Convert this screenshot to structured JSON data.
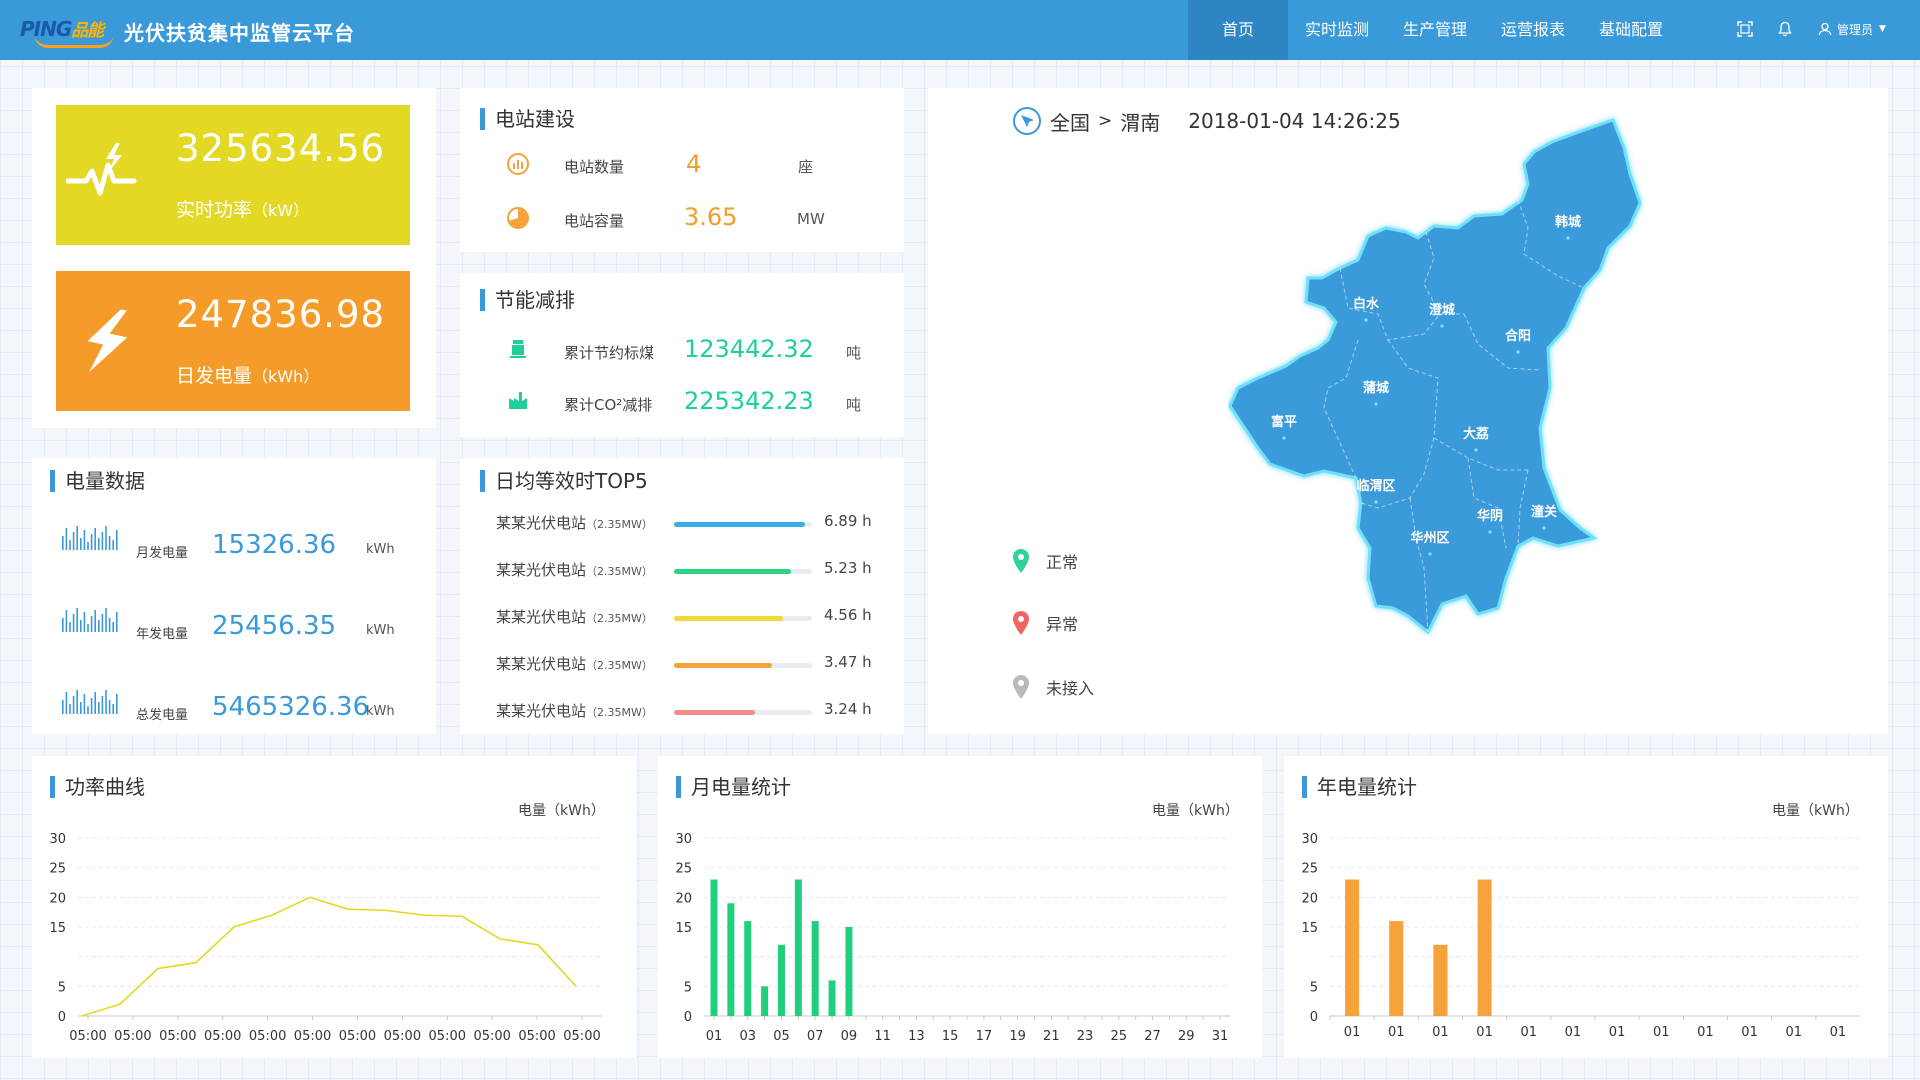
{
  "header": {
    "logo_latin": "PING",
    "logo_cn": "品能",
    "title": "光伏扶贫集中监管云平台",
    "nav": [
      {
        "label": "首页",
        "active": true
      },
      {
        "label": "实时监测",
        "active": false
      },
      {
        "label": "生产管理",
        "active": false
      },
      {
        "label": "运营报表",
        "active": false
      },
      {
        "label": "基础配置",
        "active": false
      }
    ],
    "user": "管理员"
  },
  "stats": {
    "realtime_power": {
      "value": "325634.56",
      "label": "实时功率",
      "unit": "（kW）",
      "color": "#e3d924"
    },
    "daily_energy": {
      "value": "247836.98",
      "label": "日发电量",
      "unit": "（kWh）",
      "color": "#f59b29"
    }
  },
  "station": {
    "title": "电站建设",
    "count": {
      "label": "电站数量",
      "value": "4",
      "unit": "座"
    },
    "capacity": {
      "label": "电站容量",
      "value": "3.65",
      "unit": "MW"
    }
  },
  "saving": {
    "title": "节能减排",
    "coal": {
      "label": "累计节约标煤",
      "value": "123442.32",
      "unit": "吨"
    },
    "co2": {
      "label": "累计CO²减排",
      "value": "225342.23",
      "unit": "吨"
    }
  },
  "energy": {
    "title": "电量数据",
    "monthly": {
      "label": "月发电量",
      "value": "15326.36",
      "unit": "kWh"
    },
    "yearly": {
      "label": "年发电量",
      "value": "25456.35",
      "unit": "kWh"
    },
    "total": {
      "label": "总发电量",
      "value": "5465326.36",
      "unit": "kWh"
    }
  },
  "top5": {
    "title": "日均等效时TOP5",
    "items": [
      {
        "name": "某某光伏电站",
        "cap": "（2.35MW）",
        "value": "6.89 h",
        "ratio": 0.95,
        "color": "#3aade6"
      },
      {
        "name": "某某光伏电站",
        "cap": "（2.35MW）",
        "value": "5.23 h",
        "ratio": 0.85,
        "color": "#2fd27e"
      },
      {
        "name": "某某光伏电站",
        "cap": "（2.35MW）",
        "value": "4.56 h",
        "ratio": 0.79,
        "color": "#f0d93a"
      },
      {
        "name": "某某光伏电站",
        "cap": "（2.35MW）",
        "value": "3.47 h",
        "ratio": 0.71,
        "color": "#f5a23a"
      },
      {
        "name": "某某光伏电站",
        "cap": "（2.35MW）",
        "value": "3.24 h",
        "ratio": 0.59,
        "color": "#f28c8c"
      }
    ]
  },
  "map": {
    "crumb_root": "全国",
    "crumb_sep": ">",
    "crumb_region": "渭南",
    "datetime": "2018-01-04  14:26:25",
    "legend": [
      {
        "label": "正常",
        "color": "#2fd29a"
      },
      {
        "label": "异常",
        "color": "#f06464"
      },
      {
        "label": "未接入",
        "color": "#b9b9b9"
      }
    ],
    "regions": [
      "韩城",
      "白水",
      "澄城",
      "合阳",
      "蒲城",
      "富平",
      "大荔",
      "临渭区",
      "华阴",
      "潼关",
      "华州区"
    ],
    "fill_color": "#3a9ad9"
  },
  "charts": {
    "power": {
      "title": "功率曲线",
      "unit": "电量（kWh）",
      "color": "#e3d924"
    },
    "monthly": {
      "title": "月电量统计",
      "unit": "电量（kWh）",
      "color": "#1fcf7e"
    },
    "yearly": {
      "title": "年电量统计",
      "unit": "电量（kWh）",
      "color": "#f5a23a"
    }
  },
  "chart_data": [
    {
      "type": "line",
      "title": "功率曲线",
      "ylabel": "电量（kWh）",
      "ylim": [
        0,
        30
      ],
      "yticks": [
        0,
        5,
        15,
        20,
        25,
        30
      ],
      "x": [
        "05:00",
        "05:00",
        "05:00",
        "05:00",
        "05:00",
        "05:00",
        "05:00",
        "05:00",
        "05:00",
        "05:00",
        "05:00",
        "05:00"
      ],
      "values": [
        0,
        2,
        8,
        9,
        15,
        17,
        20,
        18,
        17.8,
        17,
        16.8,
        13,
        12,
        5
      ],
      "grid": true
    },
    {
      "type": "bar",
      "title": "月电量统计",
      "ylabel": "电量（kWh）",
      "ylim": [
        0,
        30
      ],
      "yticks": [
        0,
        5,
        15,
        20,
        25,
        30
      ],
      "categories": [
        "01",
        "02",
        "03",
        "04",
        "05",
        "06",
        "07",
        "08",
        "09",
        "10",
        "11",
        "12",
        "13",
        "14",
        "15",
        "16",
        "17",
        "18",
        "19",
        "20",
        "21",
        "22",
        "23",
        "24",
        "25",
        "26",
        "27",
        "28",
        "29",
        "30",
        "31"
      ],
      "xtick_labels": [
        "01",
        "03",
        "05",
        "07",
        "09",
        "11",
        "13",
        "15",
        "17",
        "19",
        "21",
        "23",
        "25",
        "27",
        "29",
        "31"
      ],
      "values": [
        23,
        19,
        16,
        5,
        12,
        23,
        16,
        6,
        15,
        0,
        0,
        0,
        0,
        0,
        0,
        0,
        0,
        0,
        0,
        0,
        0,
        0,
        0,
        0,
        0,
        0,
        0,
        0,
        0,
        0,
        0
      ],
      "grid": true
    },
    {
      "type": "bar",
      "title": "年电量统计",
      "ylabel": "电量（kWh）",
      "ylim": [
        0,
        30
      ],
      "yticks": [
        0,
        5,
        15,
        20,
        25,
        30
      ],
      "categories": [
        "01",
        "01",
        "01",
        "01",
        "01",
        "01",
        "01",
        "01",
        "01",
        "01",
        "01",
        "01"
      ],
      "values": [
        23,
        16,
        12,
        23,
        0,
        0,
        0,
        0,
        0,
        0,
        0,
        0
      ],
      "grid": true
    }
  ]
}
